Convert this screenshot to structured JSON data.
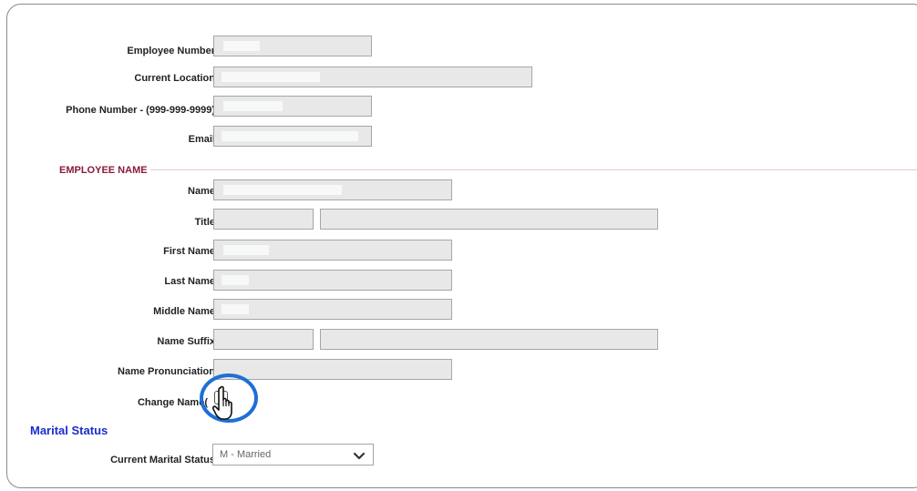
{
  "fields": {
    "employee_number_label": "Employee Number",
    "current_location_label": "Current Location",
    "phone_label": "Phone Number - (999-999-9999)",
    "email_label": "Email"
  },
  "employee_name": {
    "section_title": "EMPLOYEE NAME",
    "name_label": "Name",
    "title_label": "Title",
    "first_name_label": "First Name",
    "last_name_label": "Last Name",
    "middle_name_label": "Middle Name",
    "name_suffix_label": "Name Suffix",
    "name_pronunciation_label": "Name Pronunciation",
    "change_name_label": "Change Name("
  },
  "marital": {
    "section_title": "Marital Status",
    "current_label": "Current Marital Status",
    "current_value": "M - Married"
  },
  "colors": {
    "section_accent": "#8b1a3a",
    "marital_title": "#1a2ec9",
    "cursor_ring": "#1f6fd6"
  },
  "icons": {
    "select_arrow": "chevron-down-icon",
    "cursor": "hand-pointer-icon"
  }
}
